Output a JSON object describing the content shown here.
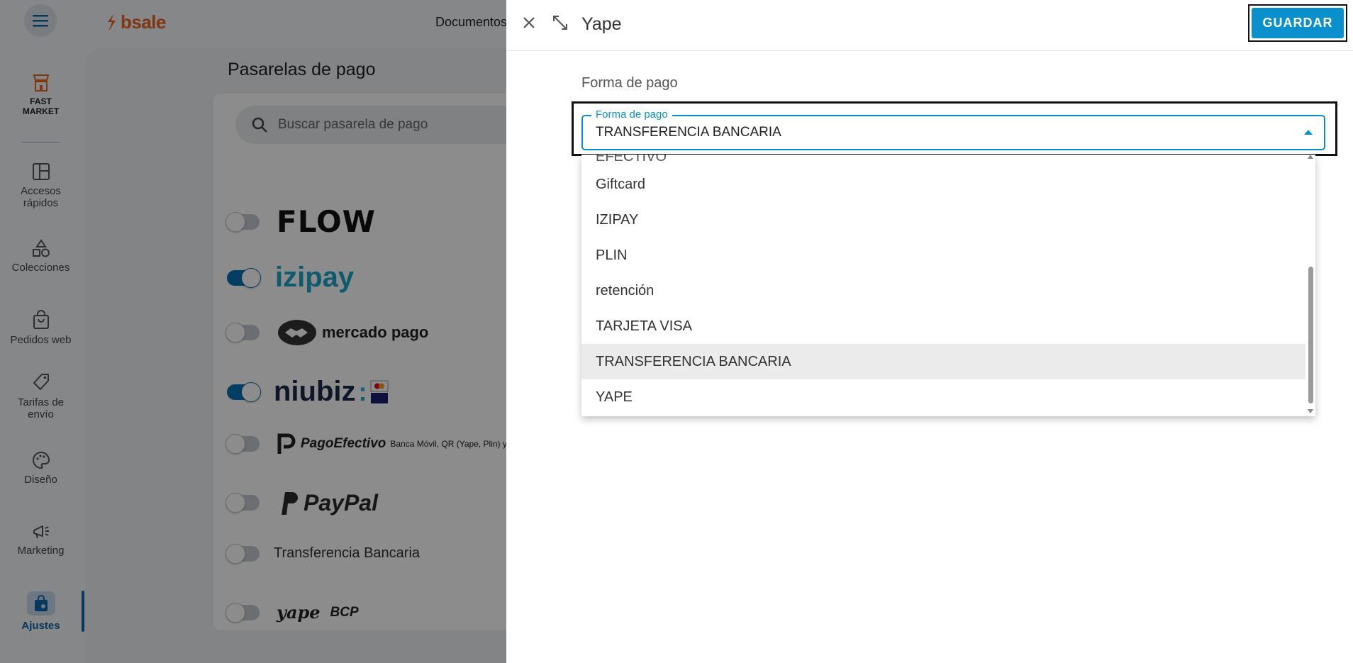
{
  "app": {
    "brand": "bsale",
    "top_nav_item": "Documentos",
    "sidebar": [
      {
        "label": "FAST MARKET",
        "icon": "fast-market-icon"
      },
      {
        "label": "Accesos rápidos",
        "icon": "grid-layout-icon"
      },
      {
        "label": "Colecciones",
        "icon": "shapes-icon"
      },
      {
        "label": "Pedidos web",
        "icon": "shopping-bag-icon"
      },
      {
        "label": "Tarifas de envío",
        "icon": "price-tag-icon"
      },
      {
        "label": "Diseño",
        "icon": "palette-icon"
      },
      {
        "label": "Marketing",
        "icon": "megaphone-icon"
      },
      {
        "label": "Ajustes",
        "icon": "settings-bag-icon",
        "active": true
      }
    ],
    "page_title": "Pasarelas de pago",
    "search_placeholder": "Buscar pasarela de pago",
    "gateways": [
      {
        "name": "FLOW",
        "enabled": false
      },
      {
        "name": "izipay",
        "enabled": true
      },
      {
        "name": "mercado pago",
        "enabled": false
      },
      {
        "name": "niubiz",
        "enabled": true
      },
      {
        "name": "PagoEfectivo",
        "subtitle": "Banca Móvil, QR (Yape, Plin) y Agen",
        "enabled": false
      },
      {
        "name": "PayPal",
        "enabled": false
      },
      {
        "name": "Transferencia Bancaria",
        "enabled": false
      },
      {
        "name": "yape",
        "secondary": "BCP",
        "enabled": false
      }
    ]
  },
  "panel": {
    "title": "Yape",
    "save_label": "GUARDAR",
    "section_label": "Forma de pago",
    "select": {
      "legend": "Forma de pago",
      "value": "TRANSFERENCIA BANCARIA"
    },
    "options": [
      {
        "label": "EFECTIVO",
        "partial": true
      },
      {
        "label": "Giftcard"
      },
      {
        "label": "IZIPAY"
      },
      {
        "label": "PLIN"
      },
      {
        "label": "retención"
      },
      {
        "label": "TARJETA VISA"
      },
      {
        "label": "TRANSFERENCIA BANCARIA",
        "selected": true
      },
      {
        "label": "YAPE"
      }
    ]
  },
  "colors": {
    "accent": "#0a90cc",
    "brand": "#e8641f",
    "active_nav": "#0a67a8"
  }
}
